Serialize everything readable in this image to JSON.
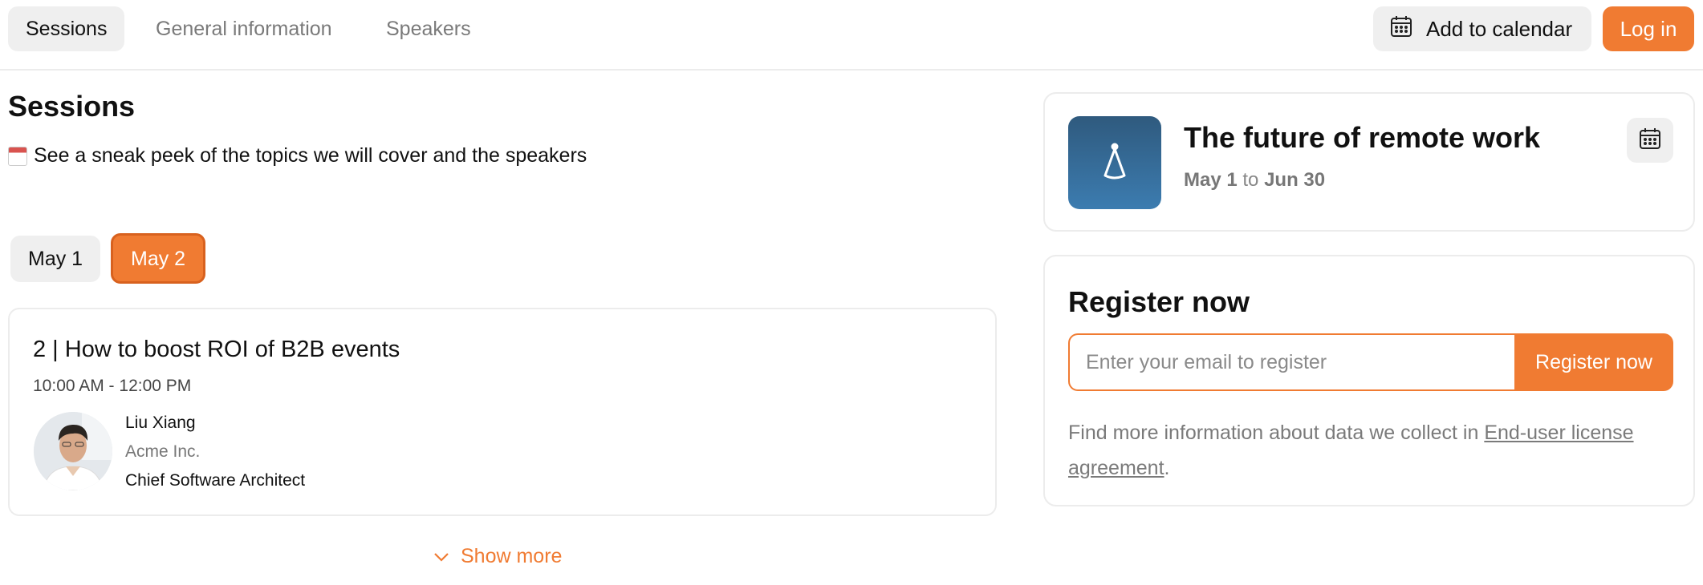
{
  "nav": {
    "tabs": [
      {
        "label": "Sessions",
        "active": true
      },
      {
        "label": "General information",
        "active": false
      },
      {
        "label": "Speakers",
        "active": false
      }
    ],
    "add_to_calendar_label": "Add to calendar",
    "login_label": "Log in"
  },
  "sessions_section": {
    "title": "Sessions",
    "subtitle": "See a sneak peek of the topics we will cover and the speakers",
    "days": [
      {
        "label": "May 1",
        "selected": false
      },
      {
        "label": "May 2",
        "selected": true
      }
    ],
    "sessions": [
      {
        "title": "2 | How to boost ROI of B2B events",
        "time": "10:00 AM - 12:00 PM",
        "speaker": {
          "name": "Liu Xiang",
          "company": "Acme Inc.",
          "role": "Chief Software Architect"
        }
      }
    ],
    "show_more_label": "Show more"
  },
  "event": {
    "title": "The future of remote work",
    "start": "May 1",
    "date_separator": "to",
    "end": "Jun 30"
  },
  "register": {
    "title": "Register now",
    "email_placeholder": "Enter your email to register",
    "button_label": "Register now",
    "info_text": "Find more information about data we collect in ",
    "link_text": "End-user license agreement",
    "info_suffix": "."
  },
  "colors": {
    "accent": "#f07b32",
    "accent_border": "#d8611e",
    "neutral_bg": "#efefef",
    "logo_gradient_top": "#2f5a7e",
    "logo_gradient_bottom": "#3c7cb0"
  },
  "icons": {
    "calendar": "calendar-icon",
    "chevron": "chevron-down-icon",
    "logo": "bell-logo-icon"
  }
}
